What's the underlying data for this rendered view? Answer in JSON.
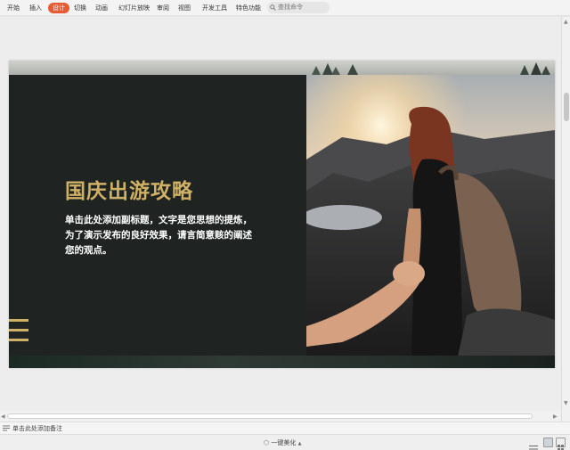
{
  "ribbon": {
    "tabs": [
      "开始",
      "插入",
      "设计",
      "切换",
      "动画",
      "幻灯片放映",
      "审阅",
      "视图",
      "开发工具",
      "特色功能"
    ],
    "active_tab": "设计",
    "search_placeholder": "查找命令"
  },
  "slide": {
    "title": "国庆出游攻略",
    "subtitle": "单击此处添加副标题，文字是您思想的提炼，为了演示发布的良好效果，请言简意赅的阐述您的观点。",
    "accent_color": "#cfb065",
    "background_color": "#1f2423"
  },
  "notes": {
    "placeholder": "单击此处添加备注"
  },
  "status": {
    "beautify_label": "一键美化"
  }
}
